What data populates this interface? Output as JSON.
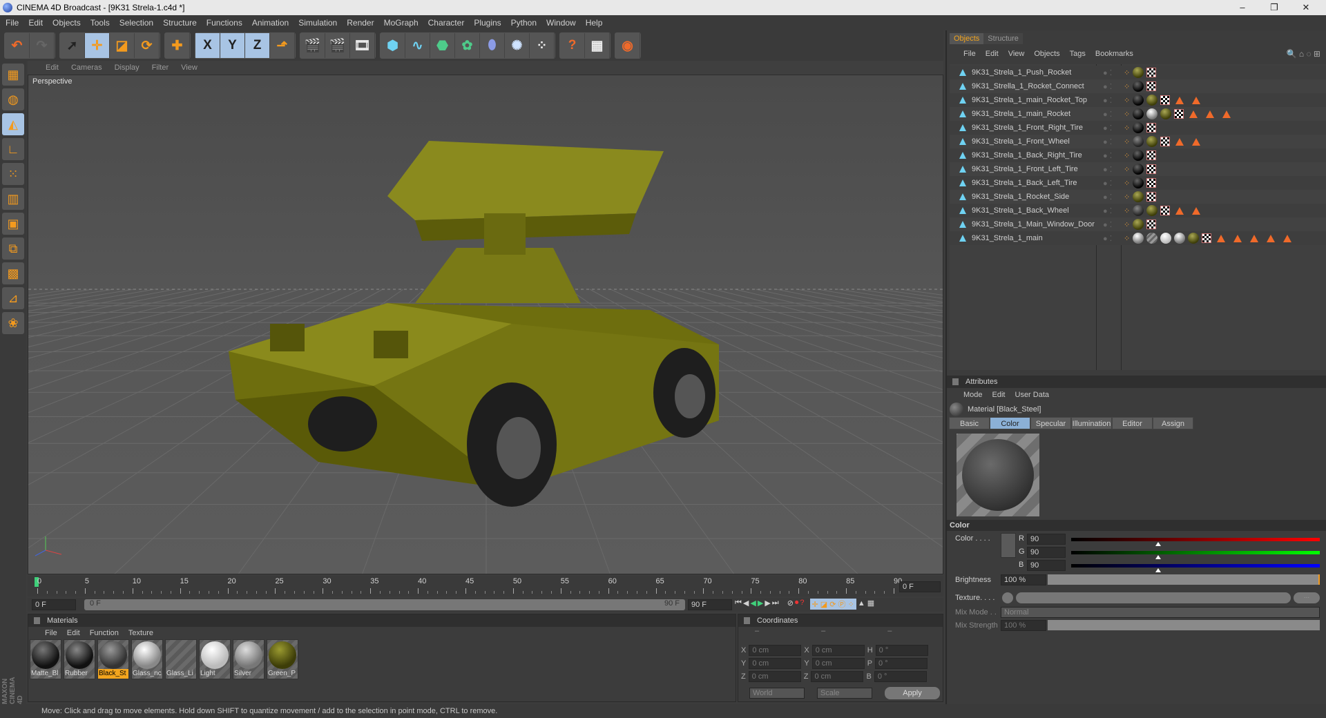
{
  "window": {
    "title": "CINEMA 4D Broadcast - [9K31 Strela-1.c4d *]",
    "minimize": "–",
    "maximize": "❐",
    "close": "✕"
  },
  "menu": [
    "File",
    "Edit",
    "Objects",
    "Tools",
    "Selection",
    "Structure",
    "Functions",
    "Animation",
    "Simulation",
    "Render",
    "MoGraph",
    "Character",
    "Plugins",
    "Python",
    "Window",
    "Help"
  ],
  "toolbar": [
    [
      {
        "icon": "undo-icon",
        "g": "↶",
        "c": "#f06a2a"
      },
      {
        "icon": "redo-icon",
        "g": "↷",
        "c": "#666"
      }
    ],
    [
      {
        "icon": "select-icon",
        "g": "➚",
        "c": "#222"
      },
      {
        "icon": "move-icon",
        "g": "✛",
        "c": "#f39a1e",
        "on": true
      },
      {
        "icon": "scale-icon",
        "g": "◪",
        "c": "#f39a1e"
      },
      {
        "icon": "rotate-icon",
        "g": "⟳",
        "c": "#f39a1e"
      }
    ],
    [
      {
        "icon": "move-plus-icon",
        "g": "✚",
        "c": "#f39a1e"
      }
    ],
    [
      {
        "icon": "x-axis-icon",
        "g": "X",
        "c": "#222",
        "on": true
      },
      {
        "icon": "y-axis-icon",
        "g": "Y",
        "c": "#222",
        "on": true
      },
      {
        "icon": "z-axis-icon",
        "g": "Z",
        "c": "#222",
        "on": true
      },
      {
        "icon": "coordinate-system-icon",
        "g": "⬏",
        "c": "#f39a1e"
      }
    ],
    [
      {
        "icon": "render-view-icon",
        "g": "🎬",
        "c": "#eee"
      },
      {
        "icon": "render-picture-viewer-icon",
        "g": "🎬",
        "c": "#f06a2a"
      },
      {
        "icon": "render-settings-icon",
        "g": "🎞",
        "c": "#eee"
      }
    ],
    [
      {
        "icon": "cube-icon",
        "g": "⬢",
        "c": "#6fd2f2"
      },
      {
        "icon": "spline-icon",
        "g": "∿",
        "c": "#6fd2f2"
      },
      {
        "icon": "nurbs-icon",
        "g": "⬣",
        "c": "#4ecb8a"
      },
      {
        "icon": "array-icon",
        "g": "✿",
        "c": "#4ecb8a"
      },
      {
        "icon": "deformer-icon",
        "g": "⬮",
        "c": "#8c9ce6"
      },
      {
        "icon": "scene-icon",
        "g": "✺",
        "c": "#cfe3ff"
      },
      {
        "icon": "particles-icon",
        "g": "⁘",
        "c": "#eee"
      }
    ],
    [
      {
        "icon": "help-icon",
        "g": "?",
        "c": "#f06a2a"
      },
      {
        "icon": "script-icon",
        "g": "▦",
        "c": "#eee"
      }
    ],
    [
      {
        "icon": "web-icon",
        "g": "◉",
        "c": "#f06a2a"
      }
    ]
  ],
  "left_tools": [
    "layout-icon",
    "model-mode-icon",
    "object-mode-icon",
    "axis-mode-icon",
    "points-mode-icon",
    "edges-mode-icon",
    "polygons-mode-icon",
    "uv-mode-icon",
    "texture-mode-icon",
    "workplane-icon",
    "sculpt-icon"
  ],
  "viewport": {
    "menu": [
      "Edit",
      "Cameras",
      "Display",
      "Filter",
      "View"
    ],
    "name": "Perspective"
  },
  "timeline": {
    "ticks": [
      0,
      5,
      10,
      15,
      20,
      25,
      30,
      35,
      40,
      45,
      50,
      55,
      60,
      65,
      70,
      75,
      80,
      85,
      90
    ],
    "current_frame": "0 F",
    "start": "0 F",
    "range_start": "0 F",
    "range_end": "90 F",
    "end": "90 F"
  },
  "materials": {
    "title": "Materials",
    "menu": [
      "File",
      "Edit",
      "Function",
      "Texture"
    ],
    "items": [
      {
        "label": "Matte_Bl",
        "c": "#111",
        "h": "#777"
      },
      {
        "label": "Rubber",
        "c": "#111",
        "h": "#888"
      },
      {
        "label": "Black_St",
        "c": "#333",
        "h": "#999",
        "sel": true
      },
      {
        "label": "Glass_nc",
        "c": "#888",
        "h": "#fff"
      },
      {
        "label": "Glass_Li",
        "c": "stripe"
      },
      {
        "label": "Light",
        "c": "#bbb",
        "h": "#fff"
      },
      {
        "label": "Silver",
        "c": "#777",
        "h": "#ddd"
      },
      {
        "label": "Green_P",
        "c": "#3d3d08",
        "h": "#9a9a30"
      }
    ]
  },
  "coordinates": {
    "title": "Coordinates",
    "cols": [
      "–",
      "–",
      "–"
    ],
    "rows": [
      [
        "X",
        "0 cm",
        "X",
        "0 cm",
        "H",
        "0 °"
      ],
      [
        "Y",
        "0 cm",
        "Y",
        "0 cm",
        "P",
        "0 °"
      ],
      [
        "Z",
        "0 cm",
        "Z",
        "0 cm",
        "B",
        "0 °"
      ]
    ],
    "world": "World",
    "scale": "Scale",
    "apply": "Apply"
  },
  "status": "Move: Click and drag to move elements. Hold down SHIFT to quantize movement / add to the selection in point mode, CTRL to remove.",
  "branding": "MAXON CINEMA 4D",
  "objects": {
    "tabs": [
      "Objects",
      "Structure"
    ],
    "menu": [
      "File",
      "Edit",
      "View",
      "Objects",
      "Tags",
      "Bookmarks"
    ],
    "rows": [
      {
        "name": "9K31_Strela_1_Push_Rocket",
        "tags": [
          "g",
          "c"
        ]
      },
      {
        "name": "9K31_Strella_1_Rocket_Connect",
        "tags": [
          "b",
          "c"
        ]
      },
      {
        "name": "9K31_Strela_1_main_Rocket_Top",
        "tags": [
          "b",
          "g",
          "c",
          "t",
          "t"
        ]
      },
      {
        "name": "9K31_Strela_1_main_Rocket",
        "tags": [
          "b",
          "s",
          "g",
          "c",
          "t",
          "t",
          "t"
        ]
      },
      {
        "name": "9K31_Strela_1_Front_Right_Tire",
        "tags": [
          "b",
          "c"
        ]
      },
      {
        "name": "9K31_Strela_1_Front_Wheel",
        "tags": [
          "d",
          "g",
          "c",
          "t",
          "t"
        ]
      },
      {
        "name": "9K31_Strela_1_Back_Right_Tire",
        "tags": [
          "b",
          "c"
        ]
      },
      {
        "name": "9K31_Strela_1_Front_Left_Tire",
        "tags": [
          "b",
          "c"
        ]
      },
      {
        "name": "9K31_Strela_1_Back_Left_Tire",
        "tags": [
          "b",
          "c"
        ]
      },
      {
        "name": "9K31_Strela_1_Rocket_Side",
        "tags": [
          "g",
          "c"
        ]
      },
      {
        "name": "9K31_Strela_1_Back_Wheel",
        "tags": [
          "d",
          "g",
          "c",
          "t",
          "t"
        ]
      },
      {
        "name": "9K31_Strela_1_Main_Window_Door",
        "tags": [
          "g",
          "c"
        ]
      },
      {
        "name": "9K31_Strela_1_main",
        "tags": [
          "s",
          "x",
          "w",
          "s",
          "g",
          "c",
          "t",
          "t",
          "t",
          "t",
          "t"
        ]
      }
    ]
  },
  "attributes": {
    "title": "Attributes",
    "menu": [
      "Mode",
      "Edit",
      "User Data"
    ],
    "material": "Material [Black_Steel]",
    "tabs": [
      "Basic",
      "Color",
      "Specular",
      "Illumination",
      "Editor",
      "Assign"
    ],
    "active_tab": "Color",
    "section": "Color",
    "color_label": "Color . . . .",
    "r_label": "R",
    "g_label": "G",
    "b_label": "B",
    "r": "90",
    "g": "90",
    "b": "90",
    "rgb_fraction": 0.35,
    "brightness_label": "Brightness",
    "brightness": "100 %",
    "texture_label": "Texture. . . .",
    "texture_more": "...",
    "mix_mode_label": "Mix Mode . .",
    "mix_mode": "Normal",
    "mix_strength_label": "Mix Strength",
    "mix_strength": "100 %"
  }
}
